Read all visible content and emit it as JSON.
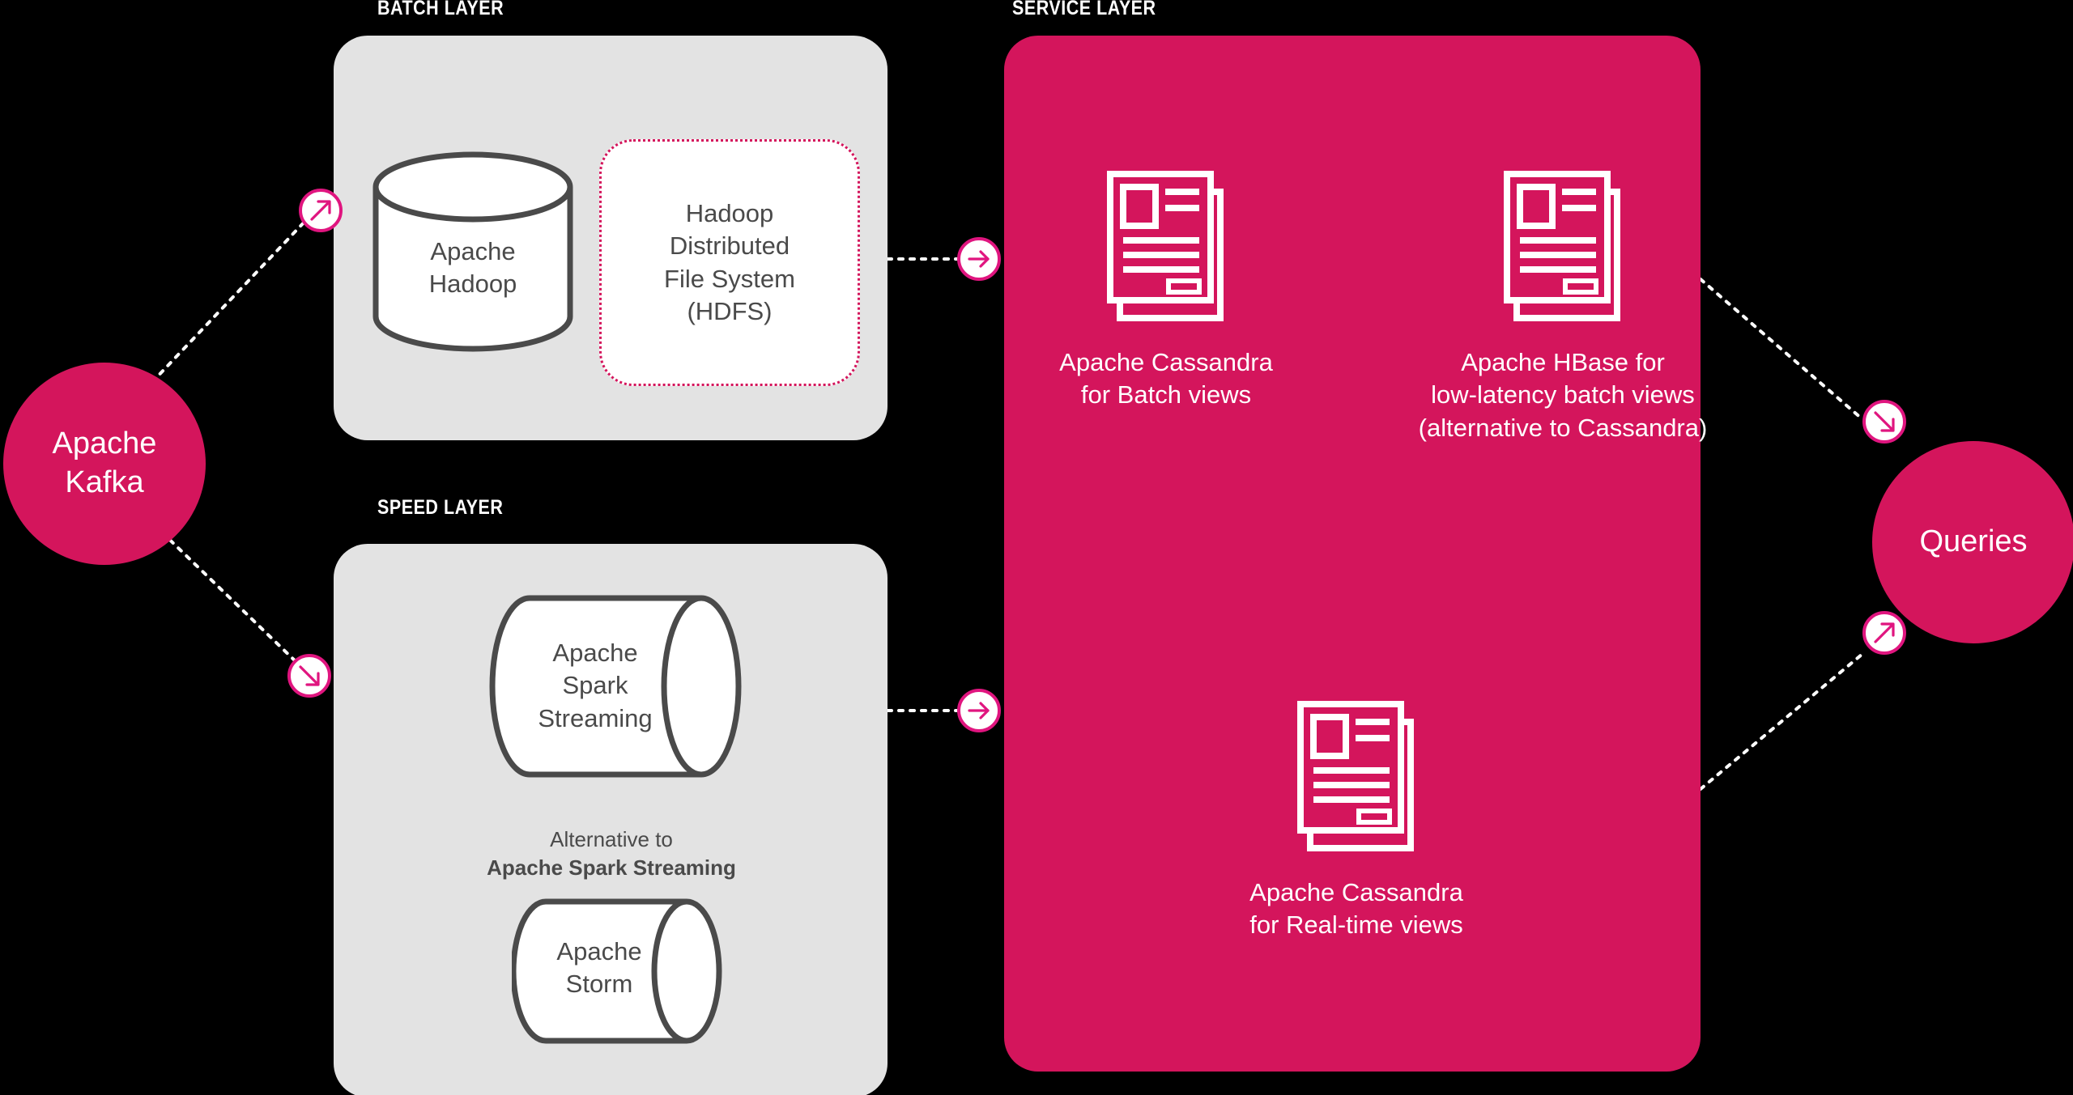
{
  "theme": {
    "background": "#000000",
    "panel_grey": "#e3e3e3",
    "panel_pink": "#d4155c",
    "accent_pink": "#e0157f",
    "text_dark": "#4a4a4a",
    "text_light": "#ffffff"
  },
  "captions": {
    "batch_layer": "BATCH LAYER",
    "speed_layer": "SPEED LAYER",
    "service_layer": "SERVICE LAYER"
  },
  "source": {
    "label_line1": "Apache",
    "label_line2": "Kafka"
  },
  "sink": {
    "label": "Queries"
  },
  "batch_layer": {
    "hadoop": {
      "line1": "Apache",
      "line2": "Hadoop"
    },
    "hdfs": {
      "line1": "Hadoop",
      "line2": "Distributed",
      "line3": "File System",
      "line4": "(HDFS)"
    }
  },
  "speed_layer": {
    "spark": {
      "line1": "Apache",
      "line2": "Spark",
      "line3": "Streaming"
    },
    "alternative_note": {
      "line1": "Alternative to",
      "line2": "Apache Spark Streaming"
    },
    "storm": {
      "line1": "Apache",
      "line2": "Storm"
    }
  },
  "service_layer": {
    "cassandra_batch": {
      "icon": "document-stack-icon",
      "line1": "Apache Cassandra",
      "line2": "for Batch views"
    },
    "hbase": {
      "icon": "document-stack-icon",
      "line1": "Apache HBase for",
      "line2": "low-latency batch views",
      "line3": "(alternative to Cassandra)"
    },
    "cassandra_realtime": {
      "icon": "document-stack-icon",
      "line1": "Apache Cassandra",
      "line2": "for Real-time views"
    }
  },
  "badges": [
    {
      "name": "kafka-to-batch",
      "icon": "arrow-up-right-icon"
    },
    {
      "name": "kafka-to-speed",
      "icon": "arrow-down-right-icon"
    },
    {
      "name": "batch-to-service",
      "icon": "arrow-right-icon"
    },
    {
      "name": "speed-to-service",
      "icon": "arrow-right-icon"
    },
    {
      "name": "service-to-queries-upper",
      "icon": "arrow-down-right-icon"
    },
    {
      "name": "service-to-queries-lower",
      "icon": "arrow-up-right-icon"
    }
  ]
}
